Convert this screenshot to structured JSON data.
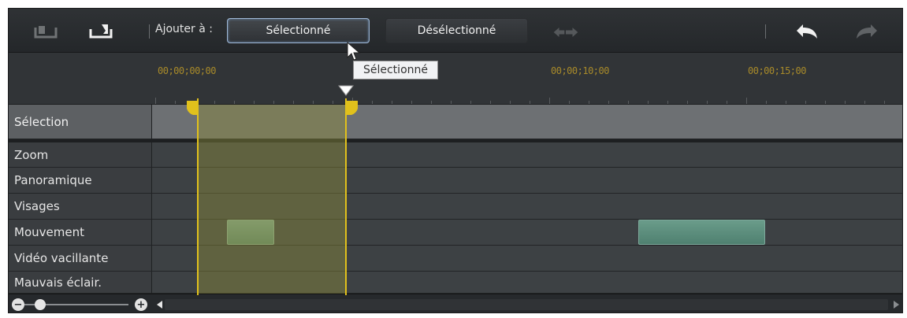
{
  "toolbar": {
    "add_to_label": "Ajouter à :",
    "selected_button": "Sélectionné",
    "deselected_button": "Désélectionné",
    "icons": [
      "import-left-icon",
      "import-right-icon",
      "swap-arrows-icon",
      "undo-icon",
      "redo-icon"
    ]
  },
  "tooltip": {
    "text": "Sélectionné"
  },
  "ruler": {
    "timecodes": [
      "00;00;00;00",
      "00;00;10;00",
      "00;00;15;00"
    ]
  },
  "rows": {
    "selection": "Sélection",
    "items": [
      {
        "label": "Zoom"
      },
      {
        "label": "Panoramique"
      },
      {
        "label": "Visages"
      },
      {
        "label": "Mouvement"
      },
      {
        "label": "Vidéo vacillante"
      },
      {
        "label": "Mauvais éclair."
      }
    ]
  },
  "bottombar": {
    "zoom_out_symbol": "−",
    "zoom_in_symbol": "+",
    "zoom_level": 0.1
  },
  "colors": {
    "accent_yellow": "#e1c11c",
    "segment_green": "#7ea890",
    "timecode": "#a88a2a"
  }
}
